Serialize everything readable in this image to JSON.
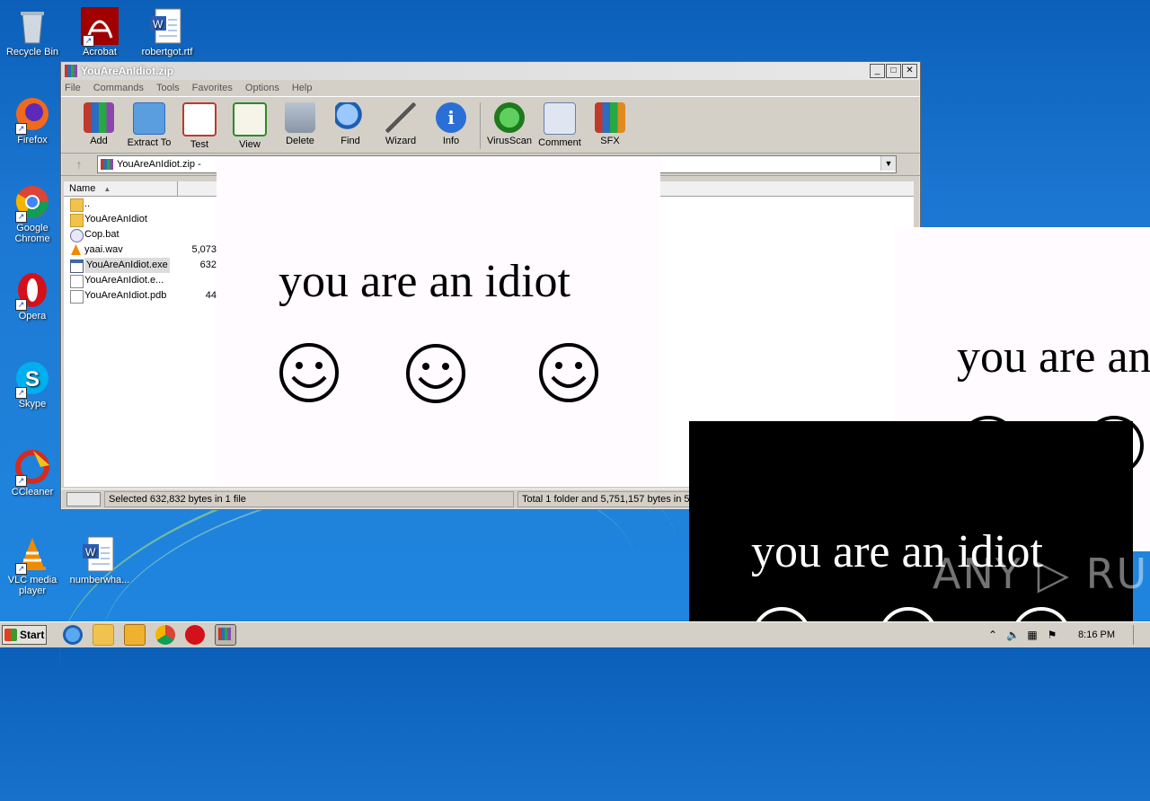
{
  "desktop": {
    "icons": [
      {
        "label": "Recycle Bin"
      },
      {
        "label": "Acrobat"
      },
      {
        "label": "robertgot.rtf"
      },
      {
        "label": "Firefox"
      },
      {
        "label": "Google Chrome"
      },
      {
        "label": "Opera"
      },
      {
        "label": "Skype"
      },
      {
        "label": "CCleaner"
      },
      {
        "label": "VLC media player"
      },
      {
        "label": "numberwha..."
      }
    ]
  },
  "window": {
    "title": "YouAreAnIdiot.zip",
    "menu": [
      "File",
      "Commands",
      "Tools",
      "Favorites",
      "Options",
      "Help"
    ],
    "toolbar": [
      "Add",
      "Extract To",
      "Test",
      "View",
      "Delete",
      "Find",
      "Wizard",
      "Info",
      "VirusScan",
      "Comment",
      "SFX"
    ],
    "address": "YouAreAnIdiot.zip -",
    "column_name": "Name",
    "files": [
      {
        "name": "..",
        "size": ""
      },
      {
        "name": "YouAreAnIdiot",
        "size": ""
      },
      {
        "name": "Cop.bat",
        "size": ""
      },
      {
        "name": "yaai.wav",
        "size": "5,073"
      },
      {
        "name": "YouAreAnIdiot.exe",
        "size": "632"
      },
      {
        "name": "YouAreAnIdiot.e...",
        "size": ""
      },
      {
        "name": "YouAreAnIdiot.pdb",
        "size": "44"
      }
    ],
    "status_left": "Selected 632,832 bytes in 1 file",
    "status_right": "Total 1 folder and 5,751,157 bytes in 5 fi"
  },
  "popups": [
    {
      "text": "you are an idiot"
    },
    {
      "text": "you are an"
    },
    {
      "text": "you are an idiot"
    }
  ],
  "watermark": "ANY ▷ RUN",
  "taskbar": {
    "start_label": "Start",
    "clock": "8:16 PM"
  }
}
